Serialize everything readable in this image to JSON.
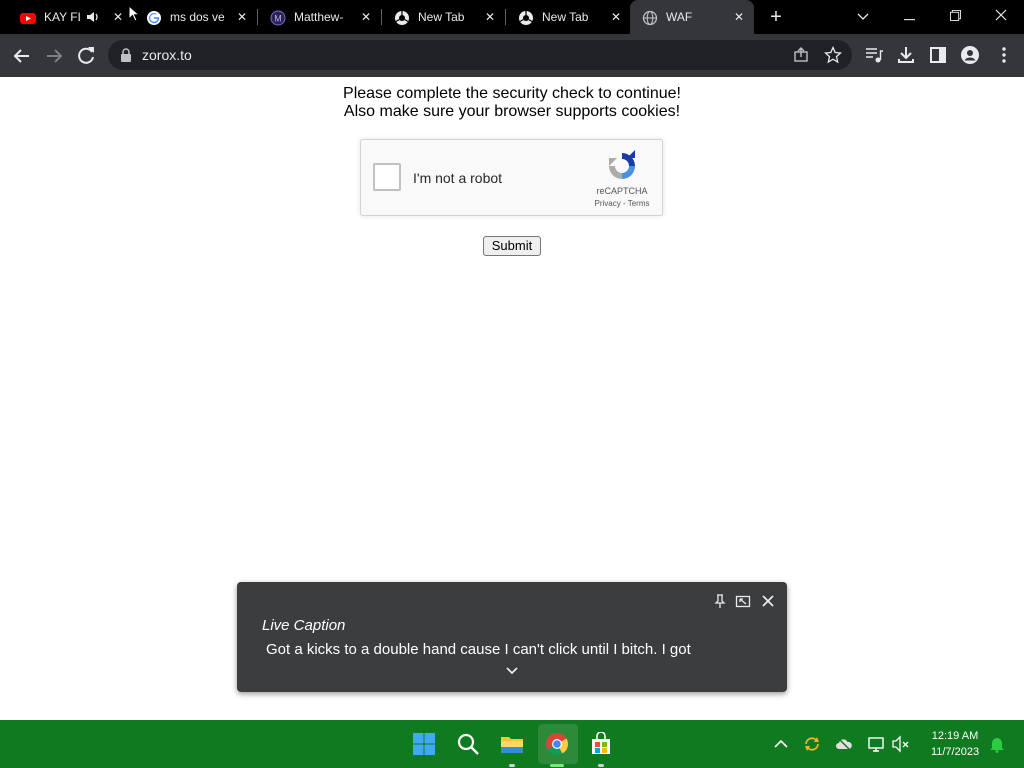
{
  "browser": {
    "tabs": [
      {
        "title": "KAY FL",
        "icon": "youtube-icon",
        "audio": true
      },
      {
        "title": "ms dos ve",
        "icon": "google-icon"
      },
      {
        "title": "Matthew-",
        "icon": "site-icon"
      },
      {
        "title": "New Tab",
        "icon": "chrome-icon"
      },
      {
        "title": "New Tab",
        "icon": "chrome-icon"
      },
      {
        "title": "WAF",
        "icon": "globe-icon",
        "active": true
      }
    ],
    "url": "zorox.to"
  },
  "page": {
    "message_line1": "Please complete the security check to continue!",
    "message_line2": "Also make sure your browser supports cookies!",
    "captcha": {
      "label": "I'm not a robot",
      "brand": "reCAPTCHA",
      "privacy": "Privacy",
      "separator": " - ",
      "terms": "Terms"
    },
    "submit_label": "Submit"
  },
  "live_caption": {
    "title": "Live Caption",
    "text": "Got a kicks to a double hand cause I can't click until I bitch. I got"
  },
  "taskbar": {
    "time": "12:19 AM",
    "date": "11/7/2023"
  },
  "colors": {
    "taskbar": "#0f7a1f",
    "tabstrip": "#000000",
    "toolbar": "#35363a"
  }
}
